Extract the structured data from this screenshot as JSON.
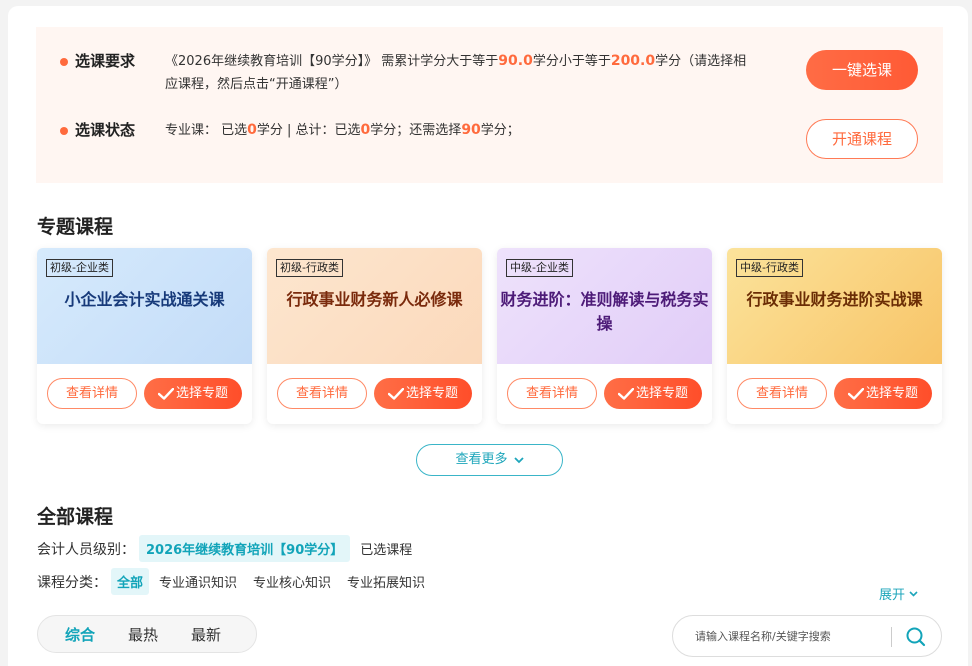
{
  "requirement": {
    "label": "选课要求",
    "text_1": "《2026年继续教育培训【90学分】》 需累计学分大于等于",
    "min_credit": "90.0",
    "text_2": "学分小于等于",
    "max_credit": "200.0",
    "text_3": "学分（请选择相应课程，然后点击“开通课程”）",
    "btn_one_click": "一键选课"
  },
  "status": {
    "label": "选课状态",
    "t1": "专业课： 已选",
    "pro_selected": "0",
    "t2": "学分 | 总计：已选",
    "total_selected": "0",
    "t3": "学分；还需选择",
    "remaining": "90",
    "t4": "学分；",
    "btn_open": "开通课程"
  },
  "special": {
    "title": "专题课程",
    "cards": [
      {
        "tag": "初级-企业类",
        "title": "小企业会计实战通关课",
        "detail": "查看详情",
        "select": "选择专题"
      },
      {
        "tag": "初级-行政类",
        "title": "行政事业财务新人必修课",
        "detail": "查看详情",
        "select": "选择专题"
      },
      {
        "tag": "中级-企业类",
        "title": "财务进阶：准则解读与税务实操",
        "detail": "查看详情",
        "select": "选择专题"
      },
      {
        "tag": "中级-行政类",
        "title": "行政事业财务进阶实战课",
        "detail": "查看详情",
        "select": "选择专题"
      }
    ],
    "more": "查看更多"
  },
  "all": {
    "title": "全部课程",
    "level_label": "会计人员级别：",
    "level_value": "2026年继续教育培训【90学分】",
    "selected_link": "已选课程",
    "cat_label": "课程分类：",
    "cats": [
      "全部",
      "专业通识知识",
      "专业核心知识",
      "专业拓展知识"
    ],
    "expand": "展开",
    "sort": [
      "综合",
      "最热",
      "最新"
    ],
    "search_placeholder": "请输入课程名称/关键字搜索"
  },
  "colors": {
    "accent": "#ff6a3d",
    "teal": "#12a4b9"
  }
}
